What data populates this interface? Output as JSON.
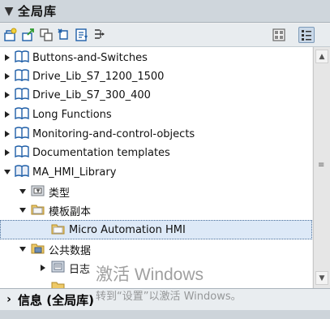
{
  "header": {
    "chevron": "▼",
    "title": "全局库"
  },
  "toolbar": {
    "buttons": [
      {
        "icon": "new-library-icon"
      },
      {
        "icon": "open-library-icon"
      },
      {
        "icon": "save-library-icon"
      },
      {
        "icon": "close-library-icon"
      },
      {
        "icon": "update-icon"
      },
      {
        "icon": "export-icon"
      },
      {
        "icon": "library-settings-icon"
      },
      {
        "icon": "library-view-icon"
      }
    ]
  },
  "tree": {
    "items": [
      {
        "label": "Buttons-and-Switches",
        "expanded": false,
        "icon": "book-icon"
      },
      {
        "label": "Drive_Lib_S7_1200_1500",
        "expanded": false,
        "icon": "book-icon"
      },
      {
        "label": "Drive_Lib_S7_300_400",
        "expanded": false,
        "icon": "book-icon"
      },
      {
        "label": "Long Functions",
        "expanded": false,
        "icon": "book-icon"
      },
      {
        "label": "Monitoring-and-control-objects",
        "expanded": false,
        "icon": "book-icon"
      },
      {
        "label": "Documentation templates",
        "expanded": false,
        "icon": "book-icon"
      },
      {
        "label": "MA_HMI_Library",
        "expanded": true,
        "icon": "book-open-icon"
      },
      {
        "label": "类型",
        "expanded": true,
        "icon": "types-folder-icon"
      },
      {
        "label": "模板副本",
        "expanded": true,
        "icon": "folder-icon"
      },
      {
        "label": "Micro Automation HMI",
        "selected": true,
        "icon": "folder-icon"
      },
      {
        "label": "公共数据",
        "expanded": true,
        "icon": "common-data-folder-icon"
      },
      {
        "label": "日志",
        "expanded": false,
        "icon": "log-icon"
      }
    ]
  },
  "footer": {
    "chevron": "›",
    "title": "信息 (全局库)"
  },
  "watermark": {
    "line1": "激活 Windows",
    "line2": "转到“设置”以激活 Windows。"
  },
  "colors": {
    "header_bg": "#cfd6dc",
    "selected_bg": "#dde9f7",
    "book_blue": "#1f5fa8",
    "folder_yellow": "#e8c25a"
  }
}
